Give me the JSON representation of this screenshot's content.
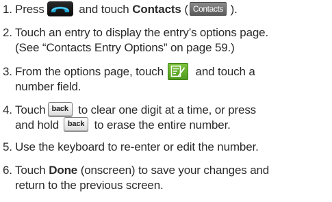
{
  "steps": [
    {
      "number": "1.",
      "text_a": "Press",
      "text_b": "and touch",
      "bold": "Contacts",
      "text_c": "(",
      "contacts_tab_label": "Contacts",
      "text_d": ")."
    },
    {
      "number": "2.",
      "line1": "Touch an entry to display the entry’s options page.",
      "line2": "(See “Contacts Entry Options” on page 59.)"
    },
    {
      "number": "3.",
      "text_a": "From the options page, touch",
      "text_b": "and touch a",
      "line2": "number field."
    },
    {
      "number": "4.",
      "text_a": "Touch",
      "back_label": "back",
      "text_b": "to clear one digit at a time, or press",
      "line2_a": "and hold",
      "line2_b": "to erase the entire number."
    },
    {
      "number": "5.",
      "line1": "Use the keyboard to re-enter or edit the number."
    },
    {
      "number": "6.",
      "text_a": "Touch",
      "bold": "Done",
      "text_b": "(onscreen) to save your changes and",
      "line2": "return to the previous screen."
    }
  ],
  "icons": {
    "phone_key": "phone-handset-icon",
    "contacts_tab": "contacts-tab-icon",
    "edit_key": "edit-note-icon",
    "back_key": "back-key-icon"
  },
  "colors": {
    "text": "#2b2b2b",
    "phone_key": "#111111",
    "phone_handset": "#1aa7d6",
    "edit_key": "#5fae28",
    "contacts_tab": "#6e6e6e"
  }
}
